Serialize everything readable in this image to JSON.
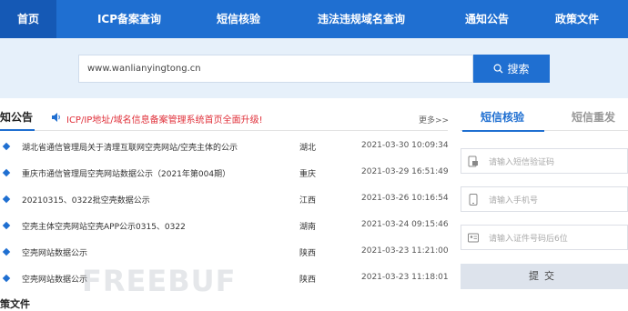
{
  "nav": {
    "items": [
      {
        "label": "首页",
        "active": true
      },
      {
        "label": "ICP备案查询"
      },
      {
        "label": "短信核验"
      },
      {
        "label": "违法违规域名查询"
      },
      {
        "label": "通知公告"
      },
      {
        "label": "政策文件"
      }
    ]
  },
  "search": {
    "value": "www.wanlianyingtong.cn",
    "button_label": "搜索"
  },
  "notice": {
    "title": "知公告",
    "marquee": "ICP/IP地址/域名信息备案管理系统首页全面升级!",
    "more": "更多>>",
    "items": [
      {
        "title": "湖北省通信管理局关于清理互联网空壳网站/空壳主体的公示",
        "location": "湖北",
        "time": "2021-03-30 10:09:34"
      },
      {
        "title": "重庆市通信管理局空壳网站数据公示（2021年第004期）",
        "location": "重庆",
        "time": "2021-03-29 16:51:49"
      },
      {
        "title": "20210315、0322批空壳数据公示",
        "location": "江西",
        "time": "2021-03-26 10:16:54"
      },
      {
        "title": "空壳主体空壳网站空壳APP公示0315、0322",
        "location": "湖南",
        "time": "2021-03-24 09:15:46"
      },
      {
        "title": "空壳网站数据公示",
        "location": "陕西",
        "time": "2021-03-23 11:21:00"
      },
      {
        "title": "空壳网站数据公示",
        "location": "陕西",
        "time": "2021-03-23 11:18:01"
      }
    ],
    "sub_heading": "策文件"
  },
  "sms_panel": {
    "tab_active": "短信核验",
    "tab_inactive": "短信重发",
    "code_placeholder": "请输入短信验证码",
    "phone_placeholder": "请输入手机号",
    "id_placeholder": "请输入证件号码后6位",
    "submit_label": "提交"
  },
  "watermark": "FREEBUF",
  "colors": {
    "primary": "#1f6fd1",
    "nav_active": "#1559b5",
    "search_band": "#e6f0fa",
    "marquee": "#e0303a"
  }
}
